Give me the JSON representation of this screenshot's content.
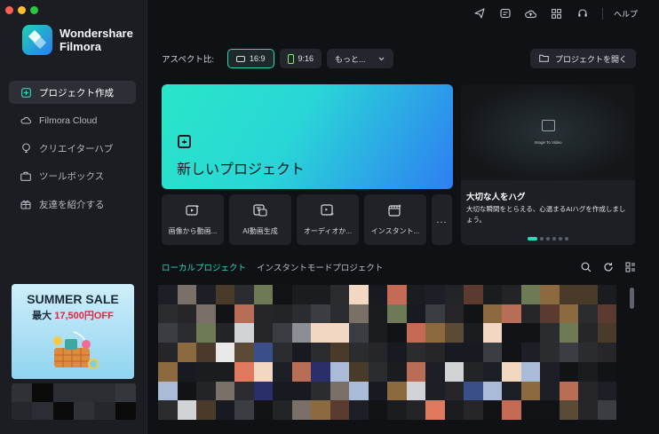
{
  "app": {
    "logo_line1": "Wondershare",
    "logo_line2": "Filmora"
  },
  "sidebar": {
    "items": [
      {
        "label": "プロジェクト作成",
        "icon": "plus-square-icon",
        "active": true
      },
      {
        "label": "Filmora Cloud",
        "icon": "cloud-icon",
        "active": false
      },
      {
        "label": "クリエイターハブ",
        "icon": "bulb-icon",
        "active": false
      },
      {
        "label": "ツールボックス",
        "icon": "toolbox-icon",
        "active": false
      },
      {
        "label": "友達を紹介する",
        "icon": "gift-icon",
        "active": false
      }
    ],
    "promo": {
      "title": "SUMMER SALE",
      "sub_prefix": "最大",
      "sub_amount": "17,500円OFF"
    }
  },
  "topbar": {
    "icons": [
      "send-icon",
      "media-icon",
      "cloud-upload-icon",
      "grid-icon",
      "support-icon"
    ],
    "help_label": "ヘルプ"
  },
  "aspect": {
    "label": "アスペクト比:",
    "options": [
      "16:9",
      "9:16"
    ],
    "selected": "16:9",
    "more_label": "もっと...",
    "open_project_label": "プロジェクトを開く"
  },
  "new_project": {
    "label": "新しいプロジェクト"
  },
  "quick_actions": [
    {
      "label": "画像から動画...",
      "icon": "image-to-video-icon"
    },
    {
      "label": "AI動画生成",
      "icon": "ai-video-icon"
    },
    {
      "label": "オーディオか...",
      "icon": "audio-icon"
    },
    {
      "label": "インスタント...",
      "icon": "instant-mode-icon"
    }
  ],
  "quick_more_label": "...",
  "feature": {
    "video_label": "Image To Video",
    "title": "大切な人をハグ",
    "description": "大切な瞬間をとらえる、心温まるAIハグを作成しましょう。",
    "dot_count": 6,
    "active_dot": 0
  },
  "project_tabs": {
    "tabs": [
      "ローカルプロジェクト",
      "インスタントモードプロジェクト"
    ],
    "active": 0,
    "tools": [
      "search-icon",
      "refresh-icon",
      "view-toggle-icon"
    ]
  },
  "colors": {
    "accent": "#2fd7bb",
    "sidebar_bg": "#1b1d22",
    "main_bg": "#101114"
  }
}
